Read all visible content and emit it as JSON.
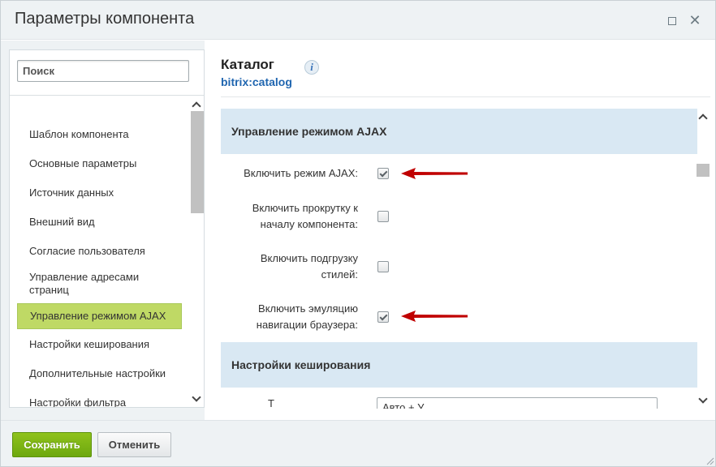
{
  "dialog": {
    "title": "Параметры компонента"
  },
  "sidebar": {
    "search_placeholder": "Поиск",
    "items": [
      {
        "label": "Шаблон компонента"
      },
      {
        "label": "Основные параметры"
      },
      {
        "label": "Источник данных"
      },
      {
        "label": "Внешний вид"
      },
      {
        "label": "Согласие пользователя"
      },
      {
        "label": "Управление адресами страниц"
      },
      {
        "label": "Управление режимом AJAX",
        "active": true
      },
      {
        "label": "Настройки кеширования"
      },
      {
        "label": "Дополнительные настройки"
      },
      {
        "label": "Настройки фильтра"
      }
    ]
  },
  "component": {
    "title": "Каталог",
    "code": "bitrix:catalog",
    "info_icon": "info-icon"
  },
  "sections": {
    "ajax": {
      "title": "Управление режимом AJAX",
      "params": [
        {
          "label": "Включить режим AJAX:",
          "checked": true,
          "highlighted": true
        },
        {
          "label": "Включить прокрутку к началу компонента:",
          "checked": false
        },
        {
          "label": "Включить подгрузку стилей:",
          "checked": false
        },
        {
          "label": "Включить эмуляцию навигации браузера:",
          "checked": true,
          "highlighted": true
        }
      ]
    },
    "cache": {
      "title": "Настройки кеширования",
      "first_label": "Т",
      "first_value": "Авто + У"
    }
  },
  "footer": {
    "save_label": "Сохранить",
    "cancel_label": "Отменить"
  },
  "colors": {
    "accent_green": "#8fc21b",
    "active_nav": "#bfd965",
    "section_bg": "#d9e8f3",
    "link_blue": "#2066b0",
    "arrow_red": "#c00000"
  }
}
